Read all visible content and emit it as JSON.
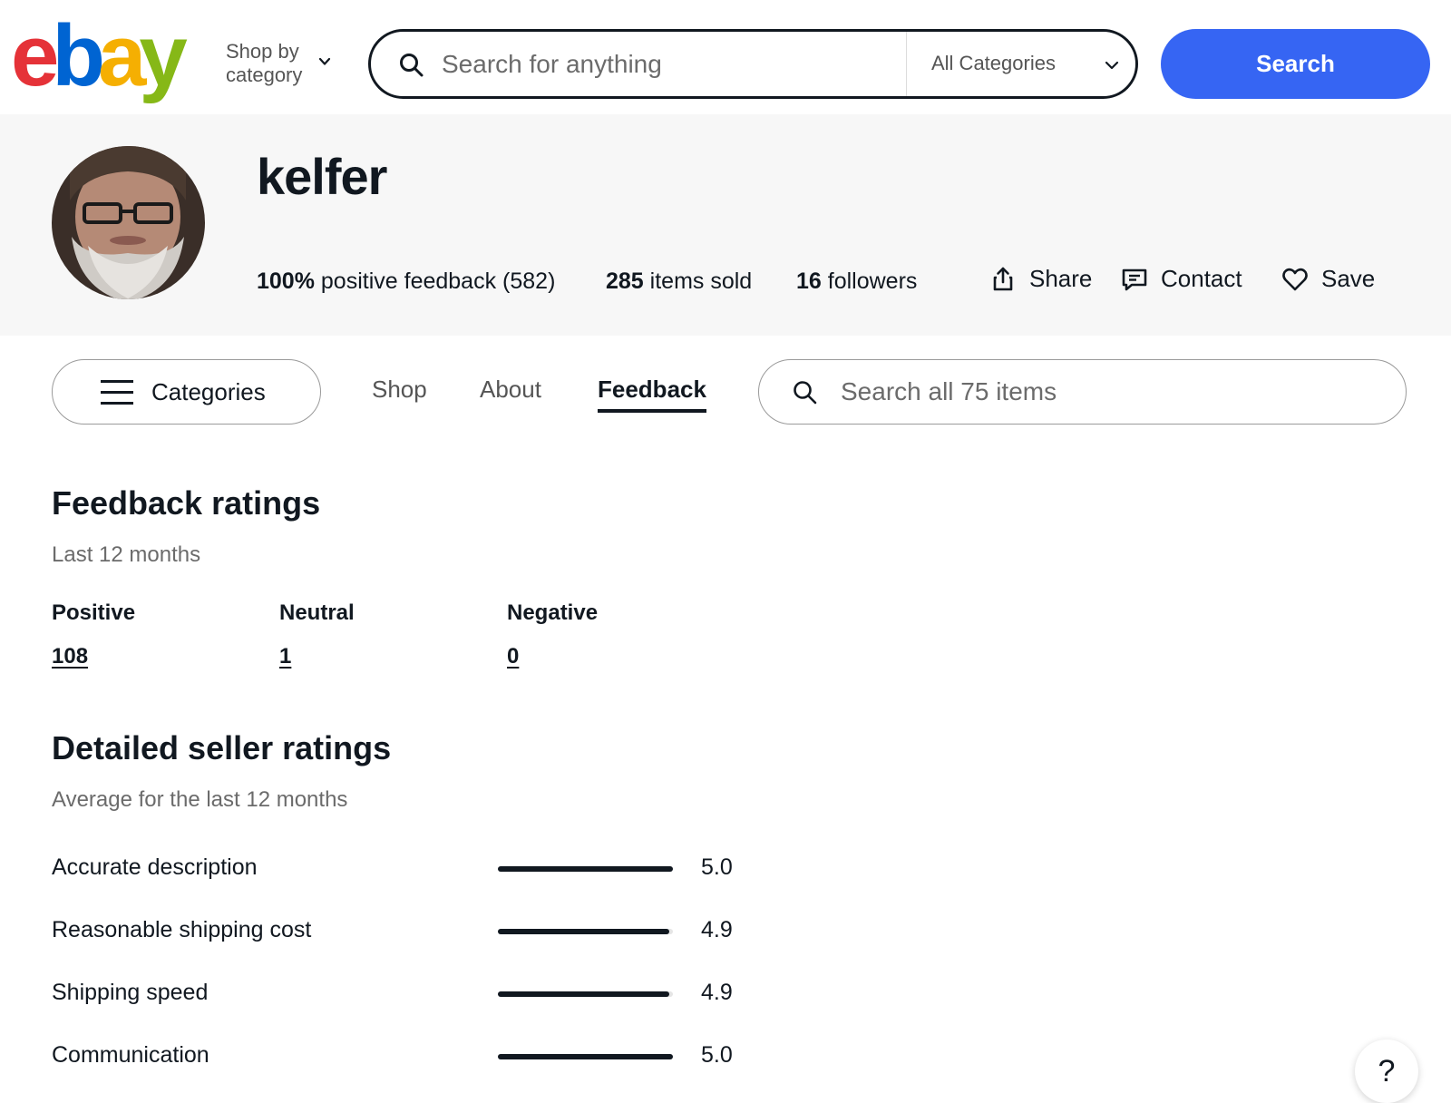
{
  "header": {
    "logo_letters": [
      "e",
      "b",
      "a",
      "y"
    ],
    "shop_by_line1": "Shop by",
    "shop_by_line2": "category",
    "search_placeholder": "Search for anything",
    "category_select": "All Categories",
    "search_button": "Search"
  },
  "profile": {
    "username": "kelfer",
    "feedback_percent": "100%",
    "feedback_text": "positive feedback (582)",
    "items_sold_count": "285",
    "items_sold_text": "items sold",
    "followers_count": "16",
    "followers_text": "followers",
    "actions": {
      "share": "Share",
      "contact": "Contact",
      "save": "Save"
    }
  },
  "tabs": {
    "categories": "Categories",
    "shop": "Shop",
    "about": "About",
    "feedback": "Feedback",
    "store_search_placeholder": "Search all 75 items"
  },
  "feedback_ratings": {
    "title": "Feedback ratings",
    "period": "Last 12 months",
    "positive_label": "Positive",
    "positive_value": "108",
    "neutral_label": "Neutral",
    "neutral_value": "1",
    "negative_label": "Negative",
    "negative_value": "0"
  },
  "detailed_ratings": {
    "title": "Detailed seller ratings",
    "period": "Average for the last 12 months",
    "max": 5,
    "items": [
      {
        "label": "Accurate description",
        "value": "5.0",
        "score": 5.0
      },
      {
        "label": "Reasonable shipping cost",
        "value": "4.9",
        "score": 4.9
      },
      {
        "label": "Shipping speed",
        "value": "4.9",
        "score": 4.9
      },
      {
        "label": "Communication",
        "value": "5.0",
        "score": 5.0
      }
    ]
  },
  "help": {
    "label": "?"
  },
  "colors": {
    "logo_e": "#e53238",
    "logo_b": "#0064d2",
    "logo_a": "#f5af02",
    "logo_y": "#86b817",
    "primary_button": "#3665f3",
    "text": "#111820",
    "muted": "#6b6b6b",
    "banner_bg": "#f7f7f7"
  }
}
